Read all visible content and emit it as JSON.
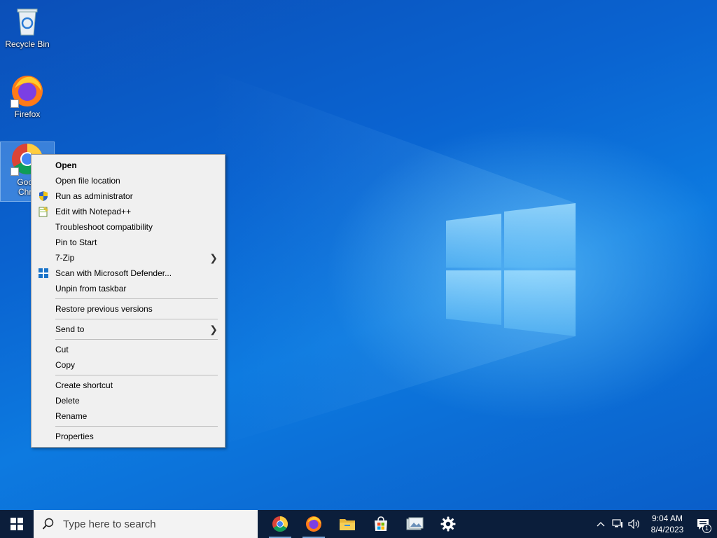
{
  "desktop": {
    "icons": [
      {
        "label": "Recycle Bin",
        "icon": "recycle-bin-icon"
      },
      {
        "label": "Firefox",
        "icon": "firefox-icon"
      },
      {
        "label": "Goog\nChro",
        "icon": "chrome-icon"
      }
    ]
  },
  "context_menu": {
    "items": [
      {
        "label": "Open",
        "bold": true
      },
      {
        "label": "Open file location"
      },
      {
        "label": "Run as administrator",
        "icon": "uac-shield-icon"
      },
      {
        "label": "Edit with Notepad++",
        "icon": "notepadpp-icon"
      },
      {
        "label": "Troubleshoot compatibility"
      },
      {
        "label": "Pin to Start"
      },
      {
        "label": "7-Zip",
        "submenu": true
      },
      {
        "label": "Scan with Microsoft Defender...",
        "icon": "defender-icon"
      },
      {
        "label": "Unpin from taskbar"
      },
      {
        "label": "Restore previous versions"
      },
      {
        "label": "Send to",
        "submenu": true
      },
      {
        "label": "Cut"
      },
      {
        "label": "Copy"
      },
      {
        "label": "Create shortcut"
      },
      {
        "label": "Delete"
      },
      {
        "label": "Rename"
      },
      {
        "label": "Properties"
      }
    ]
  },
  "taskbar": {
    "search_placeholder": "Type here to search",
    "apps": [
      "chrome-icon",
      "firefox-icon",
      "file-explorer-icon",
      "microsoft-store-icon",
      "photo-viewer-icon",
      "settings-icon"
    ],
    "tray": {
      "time": "9:04 AM",
      "date": "8/4/2023",
      "notification_count": "1"
    }
  },
  "colors": {
    "taskbar": "#0b1e3b",
    "menu_bg": "#f0f0f0",
    "wallpaper": "#0a63d0"
  }
}
